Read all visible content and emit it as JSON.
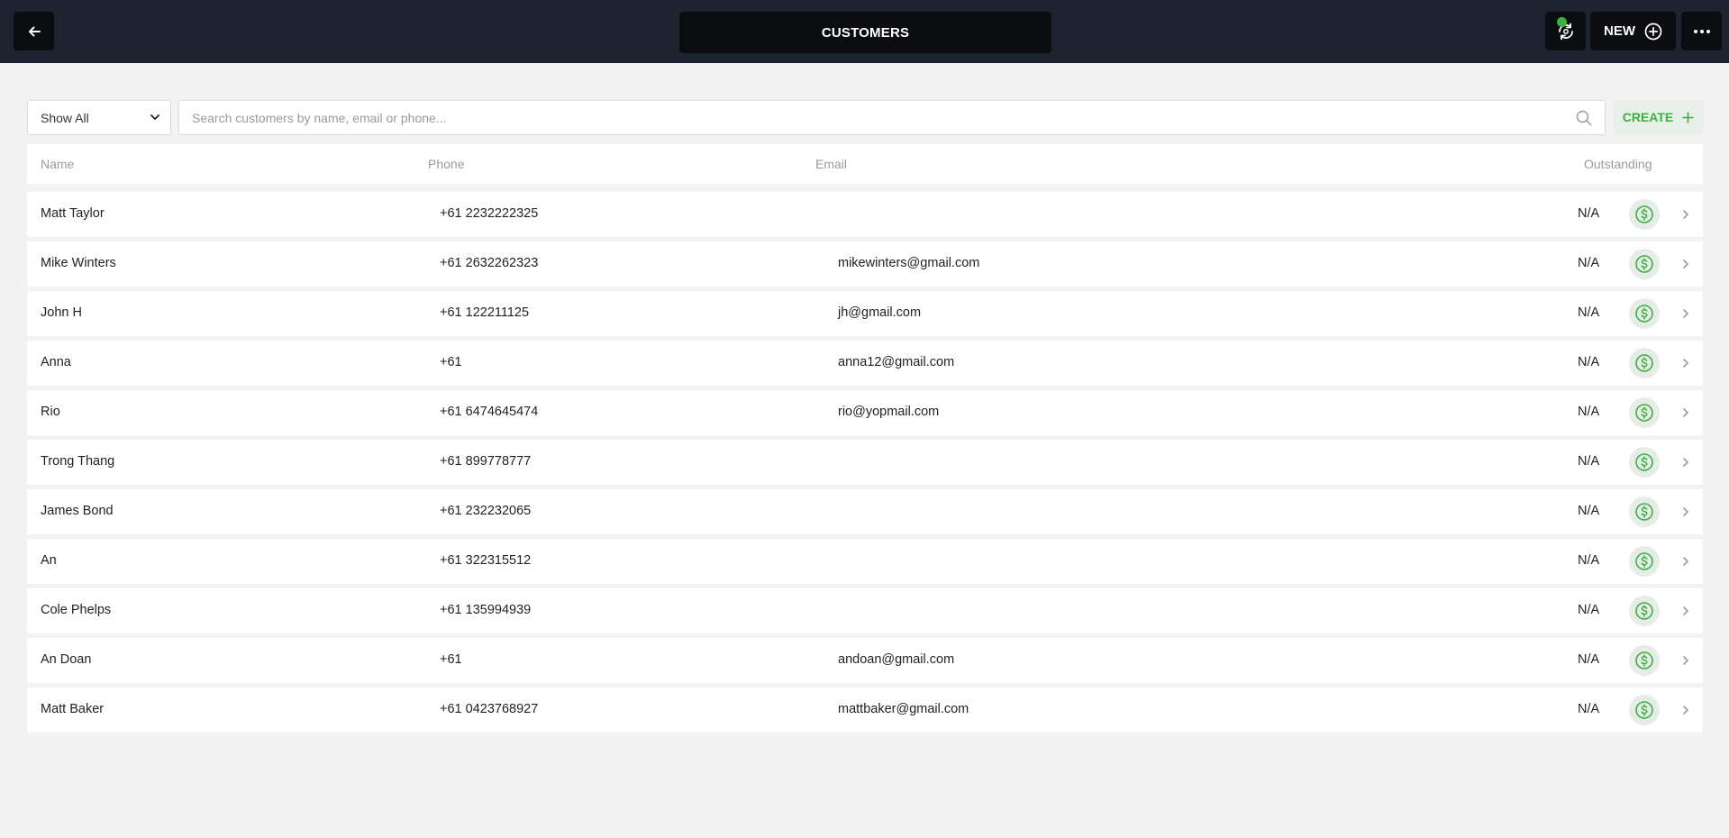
{
  "header": {
    "title": "CUSTOMERS",
    "new_label": "NEW"
  },
  "toolbar": {
    "filter_value": "Show All",
    "search_placeholder": "Search customers by name, email or phone...",
    "create_label": "CREATE"
  },
  "table": {
    "columns": {
      "name": "Name",
      "phone": "Phone",
      "email": "Email",
      "outstanding": "Outstanding"
    },
    "rows": [
      {
        "name": "Matt Taylor",
        "phone": "+61 2232222325",
        "email": "",
        "outstanding": "N/A"
      },
      {
        "name": "Mike Winters",
        "phone": "+61 2632262323",
        "email": "mikewinters@gmail.com",
        "outstanding": "N/A"
      },
      {
        "name": "John H",
        "phone": "+61 122211125",
        "email": "jh@gmail.com",
        "outstanding": "N/A"
      },
      {
        "name": "Anna",
        "phone": "+61",
        "email": "anna12@gmail.com",
        "outstanding": "N/A"
      },
      {
        "name": "Rio",
        "phone": "+61 6474645474",
        "email": "rio@yopmail.com",
        "outstanding": "N/A"
      },
      {
        "name": "Trong Thang",
        "phone": "+61 899778777",
        "email": "",
        "outstanding": "N/A"
      },
      {
        "name": "James Bond",
        "phone": "+61 232232065",
        "email": "",
        "outstanding": "N/A"
      },
      {
        "name": "An",
        "phone": "+61 322315512",
        "email": "",
        "outstanding": "N/A"
      },
      {
        "name": "Cole Phelps",
        "phone": "+61 135994939",
        "email": "",
        "outstanding": "N/A"
      },
      {
        "name": "An Doan",
        "phone": "+61",
        "email": "andoan@gmail.com",
        "outstanding": "N/A"
      },
      {
        "name": "Matt Baker",
        "phone": "+61 0423768927",
        "email": "mattbaker@gmail.com",
        "outstanding": "N/A"
      }
    ]
  },
  "icons": {
    "back": "arrow-left-icon",
    "sync": "sync-icon",
    "new": "plus-circle-icon",
    "more": "ellipsis-icon",
    "search": "search-icon",
    "create": "plus-icon",
    "payment": "dollar-circle-icon",
    "row_open": "chevron-right-icon"
  },
  "colors": {
    "topbar": "#1e2330",
    "accent_green": "#3cb043",
    "background": "#f2f2f2"
  }
}
